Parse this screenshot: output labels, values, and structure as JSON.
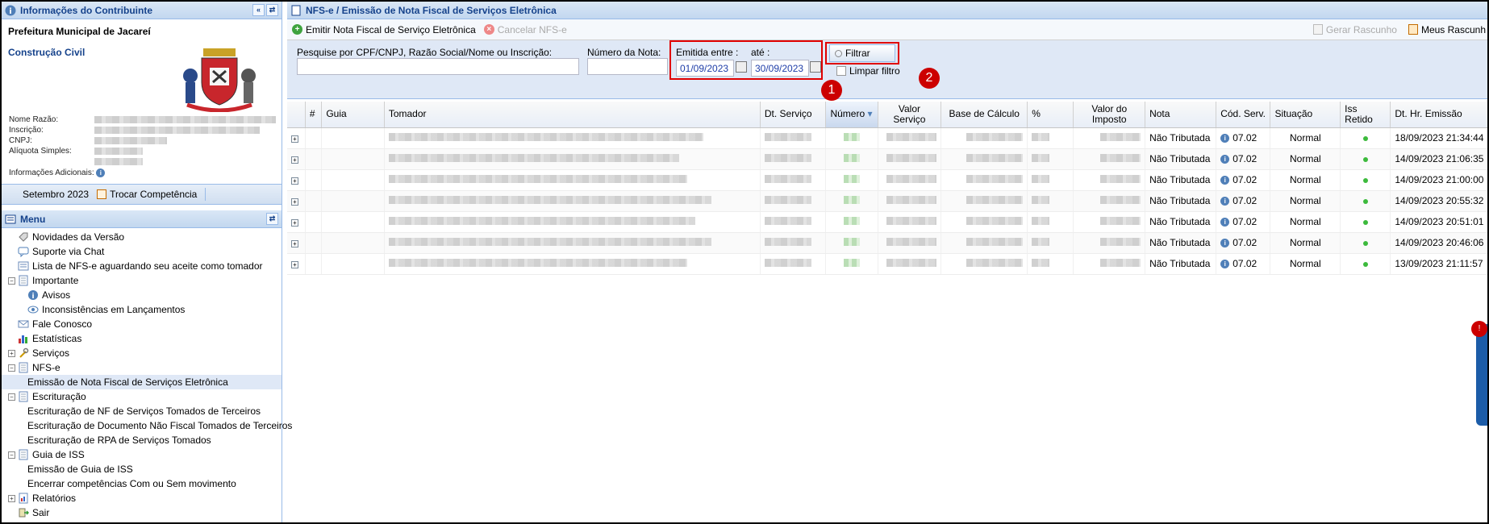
{
  "left": {
    "contrib_title": "Informações do Contribuinte",
    "city": "Prefeitura Municipal de Jacareí",
    "segment": "Construção Civil",
    "fields": [
      "Nome Razão:",
      "Inscrição:",
      "CNPJ:",
      "Alíquota Simples:"
    ],
    "extra_info": "Informações Adicionais:",
    "competence_month": "Setembro 2023",
    "change_competence": "Trocar Competência",
    "menu_title": "Menu",
    "menu": [
      {
        "label": "Novidades da Versão",
        "level": 0,
        "expander": "",
        "icon": "tag-icon"
      },
      {
        "label": "Suporte via Chat",
        "level": 0,
        "expander": "",
        "icon": "chat-icon"
      },
      {
        "label": "Lista de NFS-e aguardando seu aceite como tomador",
        "level": 0,
        "expander": "",
        "icon": "list-icon"
      },
      {
        "label": "Importante",
        "level": 0,
        "expander": "−",
        "icon": "document-icon"
      },
      {
        "label": "Avisos",
        "level": 1,
        "expander": "",
        "icon": "info-icon"
      },
      {
        "label": "Inconsistências em Lançamentos",
        "level": 1,
        "expander": "",
        "icon": "eye-icon"
      },
      {
        "label": "Fale Conosco",
        "level": 0,
        "expander": "",
        "icon": "mail-icon"
      },
      {
        "label": "Estatísticas",
        "level": 0,
        "expander": "",
        "icon": "chart-icon"
      },
      {
        "label": "Serviços",
        "level": 0,
        "expander": "+",
        "icon": "tools-icon"
      },
      {
        "label": "NFS-e",
        "level": 0,
        "expander": "−",
        "icon": "document-icon"
      },
      {
        "label": "Emissão de Nota Fiscal de Serviços Eletrônica",
        "level": 1,
        "expander": "",
        "icon": "",
        "selected": true
      },
      {
        "label": "Escrituração",
        "level": 0,
        "expander": "−",
        "icon": "document-icon"
      },
      {
        "label": "Escrituração de NF de Serviços Tomados de Terceiros",
        "level": 1,
        "expander": "",
        "icon": ""
      },
      {
        "label": "Escrituração de Documento Não Fiscal Tomados de Terceiros",
        "level": 1,
        "expander": "",
        "icon": ""
      },
      {
        "label": "Escrituração de RPA de Serviços Tomados",
        "level": 1,
        "expander": "",
        "icon": ""
      },
      {
        "label": "Guia de ISS",
        "level": 0,
        "expander": "−",
        "icon": "document-icon"
      },
      {
        "label": "Emissão de Guia de ISS",
        "level": 1,
        "expander": "",
        "icon": ""
      },
      {
        "label": "Encerrar competências Com ou Sem movimento",
        "level": 1,
        "expander": "",
        "icon": ""
      },
      {
        "label": "Relatórios",
        "level": 0,
        "expander": "+",
        "icon": "report-icon"
      },
      {
        "label": "Sair",
        "level": 0,
        "expander": "",
        "icon": "exit-icon"
      }
    ]
  },
  "main": {
    "title": "NFS-e / Emissão de Nota Fiscal de Serviços Eletrônica",
    "toolbar": {
      "emit": "Emitir Nota Fiscal de Serviço Eletrônica",
      "cancel": "Cancelar NFS-e",
      "draft": "Gerar Rascunho",
      "my_drafts": "Meus Rascunh"
    },
    "filter": {
      "search_label": "Pesquise por CPF/CNPJ, Razão Social/Nome ou Inscrição:",
      "search_value": "",
      "number_label": "Número da Nota:",
      "number_value": "",
      "from_label": "Emitida entre :",
      "from_value": "01/09/2023",
      "to_label": "até :",
      "to_value": "30/09/2023",
      "filter_button": "Filtrar",
      "clear_filter": "Limpar filtro",
      "badge1": "1",
      "badge2": "2"
    },
    "columns": [
      "#",
      "Guia",
      "Tomador",
      "Dt. Serviço",
      "Número",
      "Valor Serviço",
      "Base de Cálculo",
      "%",
      "Valor do Imposto",
      "Nota",
      "Cód. Serv.",
      "Situação",
      "Iss Retido",
      "Dt. Hr. Emissão"
    ],
    "rows": [
      {
        "nota": "Não Tributada",
        "cod": "07.02",
        "situacao": "Normal",
        "emissao": "18/09/2023 21:34:44"
      },
      {
        "nota": "Não Tributada",
        "cod": "07.02",
        "situacao": "Normal",
        "emissao": "14/09/2023 21:06:35"
      },
      {
        "nota": "Não Tributada",
        "cod": "07.02",
        "situacao": "Normal",
        "emissao": "14/09/2023 21:00:00"
      },
      {
        "nota": "Não Tributada",
        "cod": "07.02",
        "situacao": "Normal",
        "emissao": "14/09/2023 20:55:32"
      },
      {
        "nota": "Não Tributada",
        "cod": "07.02",
        "situacao": "Normal",
        "emissao": "14/09/2023 20:51:01"
      },
      {
        "nota": "Não Tributada",
        "cod": "07.02",
        "situacao": "Normal",
        "emissao": "14/09/2023 20:46:06"
      },
      {
        "nota": "Não Tributada",
        "cod": "07.02",
        "situacao": "Normal",
        "emissao": "13/09/2023 21:11:57"
      }
    ]
  },
  "colors": {
    "accent": "#15428b",
    "highlight": "#e00000",
    "header_bg": "#dfe8f6"
  }
}
